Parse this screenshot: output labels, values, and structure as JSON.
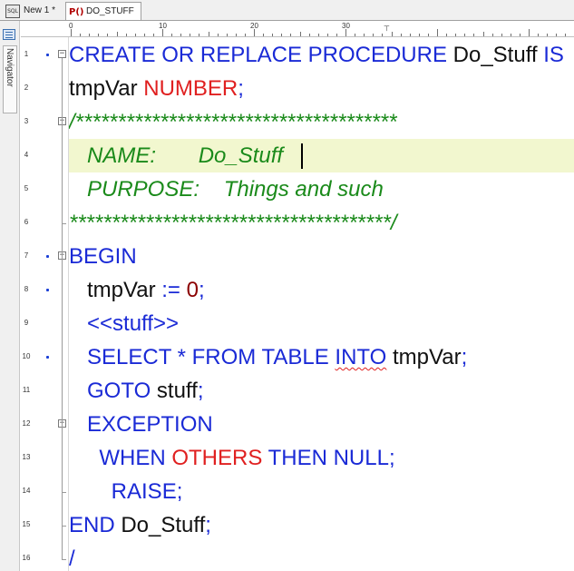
{
  "tabs": [
    {
      "icon": "sql-file-icon",
      "badge": "SQL",
      "label": "New 1 *"
    },
    {
      "icon": "procedure-icon",
      "badge": "P()",
      "label": "DO_STUFF"
    }
  ],
  "navigator": {
    "label": "Navigator"
  },
  "ruler": {
    "marks": [
      "0",
      "10",
      "20",
      "30"
    ]
  },
  "line_numbers": [
    "1",
    "2",
    "3",
    "4",
    "5",
    "6",
    "7",
    "8",
    "9",
    "10",
    "11",
    "12",
    "13",
    "14",
    "15",
    "16"
  ],
  "code": {
    "l1": {
      "t1": "CREATE OR REPLACE PROCEDURE ",
      "t2": "Do_Stuff",
      "t3": " IS"
    },
    "l2": {
      "t1": "tmpVar ",
      "t2": "NUMBER",
      "t3": ";"
    },
    "l3": {
      "t1": "/**************************************"
    },
    "l4": {
      "t1": "   NAME:       Do_Stuff"
    },
    "l5": {
      "t1": "   PURPOSE:    Things and such"
    },
    "l6": {
      "t1": "**************************************/"
    },
    "l7": {
      "t1": "BEGIN"
    },
    "l8": {
      "t1": "   tmpVar ",
      "t2": ":= ",
      "t3": "0",
      "t4": ";"
    },
    "l9": {
      "t1": "   <<stuff>>"
    },
    "l10": {
      "t1": "   SELECT * FROM TABLE ",
      "t2": "INTO",
      "t3": " tmpVar",
      "t4": ";"
    },
    "l11": {
      "t1": "   GOTO ",
      "t2": "stuff",
      "t3": ";"
    },
    "l12": {
      "t1": "   EXCEPTION"
    },
    "l13": {
      "t1": "     WHEN ",
      "t2": "OTHERS",
      "t3": " THEN NULL;"
    },
    "l14": {
      "t1": "       RAISE;"
    },
    "l15": {
      "t1": "END ",
      "t2": "Do_Stuff",
      "t3": ";"
    },
    "l16": {
      "t1": "/"
    }
  },
  "colors": {
    "keyword": "#1a2ad6",
    "type": "#e02020",
    "number": "#8b0000",
    "comment": "#1a8a1a",
    "current_line": "#f2f7cf"
  }
}
